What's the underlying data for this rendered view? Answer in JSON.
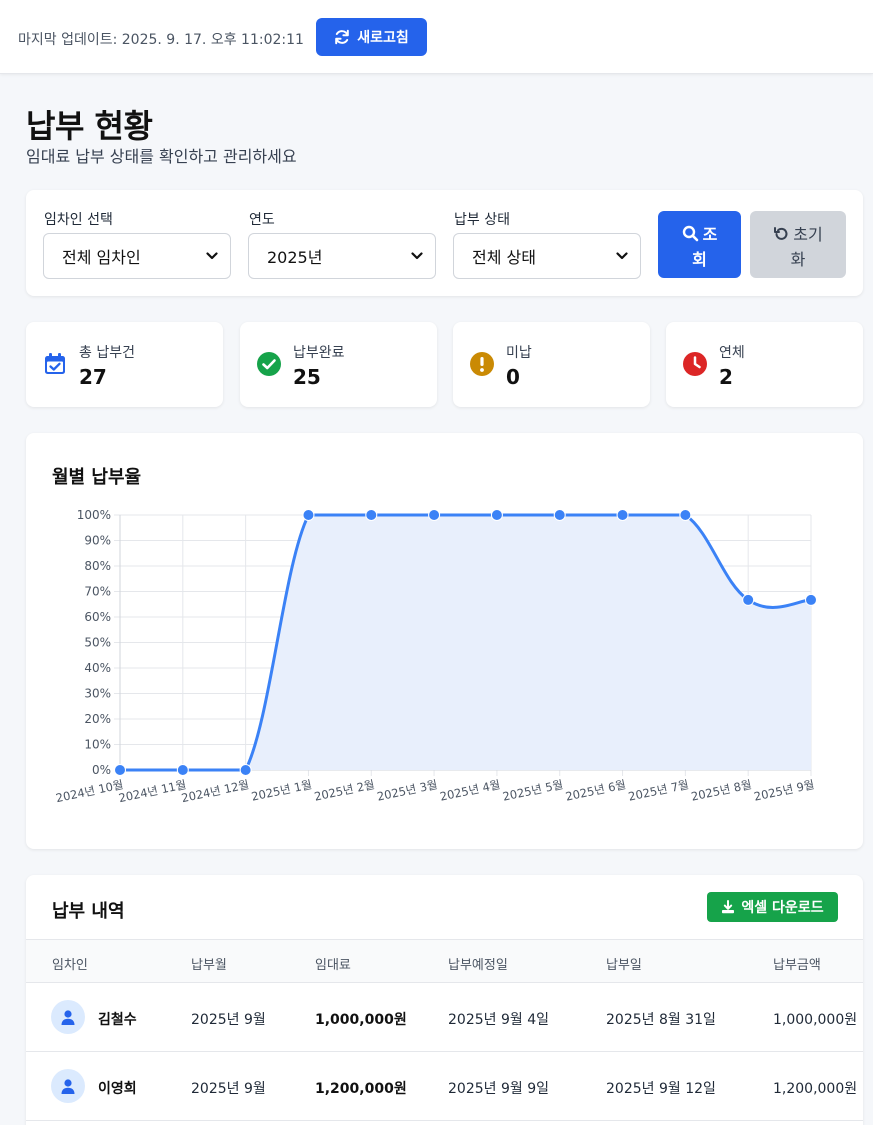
{
  "topbar": {
    "last_update": "마지막 업데이트: 2025. 9. 17. 오후 11:02:11",
    "refresh_label": "새로고침"
  },
  "page": {
    "title": "납부 현황",
    "subtitle": "임대료 납부 상태를 확인하고 관리하세요"
  },
  "filters": {
    "tenant_label": "임차인 선택",
    "tenant_value": "전체 임차인",
    "year_label": "연도",
    "year_value": "2025년",
    "status_label": "납부 상태",
    "status_value": "전체 상태",
    "search_label_1": "조",
    "search_label_2": "회",
    "reset_label_1": "초기",
    "reset_label_2": "화"
  },
  "stats": [
    {
      "label": "총 납부건",
      "value": "27",
      "icon": "calendar-check-icon",
      "color": "#2563eb"
    },
    {
      "label": "납부완료",
      "value": "25",
      "icon": "check-circle-icon",
      "color": "#16a34a"
    },
    {
      "label": "미납",
      "value": "0",
      "icon": "exclamation-circle-icon",
      "color": "#ca8a04"
    },
    {
      "label": "연체",
      "value": "2",
      "icon": "clock-icon",
      "color": "#dc2626"
    }
  ],
  "chart_data": {
    "type": "line",
    "title": "월별 납부율",
    "categories": [
      "2024년 10월",
      "2024년 11월",
      "2024년 12월",
      "2025년 1월",
      "2025년 2월",
      "2025년 3월",
      "2025년 4월",
      "2025년 5월",
      "2025년 6월",
      "2025년 7월",
      "2025년 8월",
      "2025년 9월"
    ],
    "values": [
      0,
      0,
      0,
      100,
      100,
      100,
      100,
      100,
      100,
      100,
      66.7,
      66.7
    ],
    "y_ticks": [
      "0%",
      "10%",
      "20%",
      "30%",
      "40%",
      "50%",
      "60%",
      "70%",
      "80%",
      "90%",
      "100%"
    ],
    "ylim": [
      0,
      100
    ],
    "grid": true,
    "color": "#3b82f6",
    "fill": "#e8effc"
  },
  "table": {
    "title": "납부 내역",
    "excel_label": "엑셀 다운로드",
    "headers": [
      "임차인",
      "납부월",
      "임대료",
      "납부예정일",
      "납부일",
      "납부금액"
    ],
    "rows": [
      {
        "tenant": "김철수",
        "month": "2025년 9월",
        "rent": "1,000,000원",
        "due": "2025년 9월 4일",
        "paid": "2025년 8월 31일",
        "amount": "1,000,000원"
      },
      {
        "tenant": "이영희",
        "month": "2025년 9월",
        "rent": "1,200,000원",
        "due": "2025년 9월 9일",
        "paid": "2025년 9월 12일",
        "amount": "1,200,000원"
      }
    ]
  }
}
